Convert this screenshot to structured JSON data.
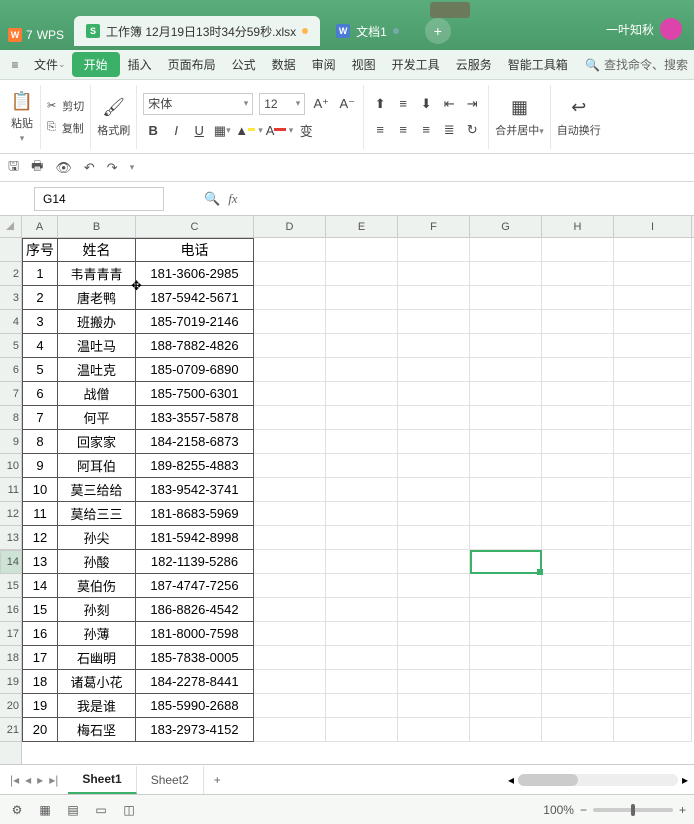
{
  "titlebar": {
    "wps_label": "WPS",
    "tab1_label": "工作簿 12月19日13时34分59秒.xlsx",
    "tab2_label": "文档1",
    "username": "一叶知秋"
  },
  "menubar": {
    "file": "文件",
    "start": "开始",
    "insert": "插入",
    "layout": "页面布局",
    "formula": "公式",
    "data": "数据",
    "review": "审阅",
    "view": "视图",
    "dev": "开发工具",
    "cloud": "云服务",
    "smart": "智能工具箱",
    "search": "查找命令、搜索"
  },
  "ribbon": {
    "paste": "粘贴",
    "cut": "剪切",
    "copy": "复制",
    "brush": "格式刷",
    "font_name": "宋体",
    "font_size": "12",
    "merge": "合并居中",
    "wrap": "自动换行"
  },
  "fxbar": {
    "cellref": "G14",
    "fx": "fx"
  },
  "cols": {
    "A": "A",
    "B": "B",
    "C": "C",
    "D": "D",
    "E": "E",
    "F": "F",
    "G": "G",
    "H": "H",
    "I": "I"
  },
  "table": {
    "hdr_no": "序号",
    "hdr_name": "姓名",
    "hdr_phone": "电话",
    "rows": [
      {
        "n": "1",
        "name": "韦青青青",
        "ph": "181-3606-2985"
      },
      {
        "n": "2",
        "name": "唐老鸭",
        "ph": "187-5942-5671"
      },
      {
        "n": "3",
        "name": "班搬办",
        "ph": "185-7019-2146"
      },
      {
        "n": "4",
        "name": "温吐马",
        "ph": "188-7882-4826"
      },
      {
        "n": "5",
        "name": "温吐克",
        "ph": "185-0709-6890"
      },
      {
        "n": "6",
        "name": "战僧",
        "ph": "185-7500-6301"
      },
      {
        "n": "7",
        "name": "何平",
        "ph": "183-3557-5878"
      },
      {
        "n": "8",
        "name": "回家家",
        "ph": "184-2158-6873"
      },
      {
        "n": "9",
        "name": "阿耳伯",
        "ph": "189-8255-4883"
      },
      {
        "n": "10",
        "name": "莫三给给",
        "ph": "183-9542-3741"
      },
      {
        "n": "11",
        "name": "莫给三三",
        "ph": "181-8683-5969"
      },
      {
        "n": "12",
        "name": "孙尖",
        "ph": "181-5942-8998"
      },
      {
        "n": "13",
        "name": "孙酸",
        "ph": "182-1139-5286"
      },
      {
        "n": "14",
        "name": "莫伯伤",
        "ph": "187-4747-7256"
      },
      {
        "n": "15",
        "name": "孙刻",
        "ph": "186-8826-4542"
      },
      {
        "n": "16",
        "name": "孙薄",
        "ph": "181-8000-7598"
      },
      {
        "n": "17",
        "name": "石幽明",
        "ph": "185-7838-0005"
      },
      {
        "n": "18",
        "name": "诸葛小花",
        "ph": "184-2278-8441"
      },
      {
        "n": "19",
        "name": "我是谁",
        "ph": "185-5990-2688"
      },
      {
        "n": "20",
        "name": "梅石坚",
        "ph": "183-2973-4152"
      }
    ]
  },
  "sheets": {
    "s1": "Sheet1",
    "s2": "Sheet2"
  },
  "status": {
    "zoom": "100%"
  }
}
